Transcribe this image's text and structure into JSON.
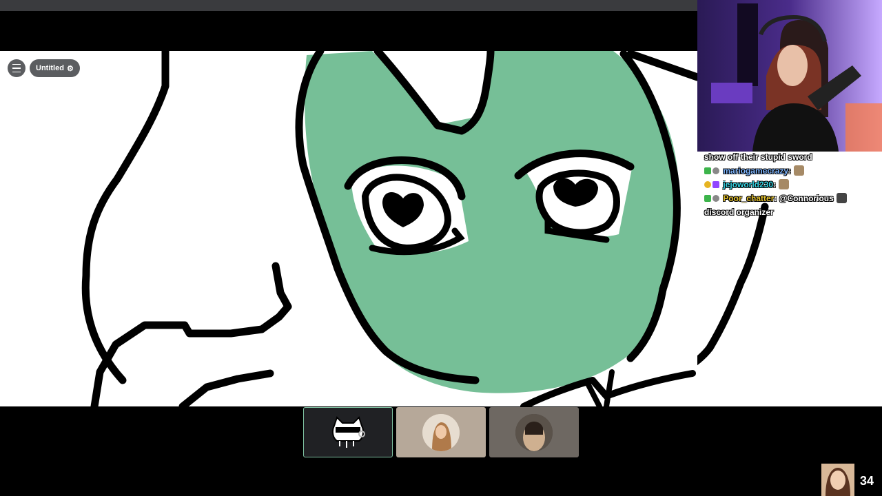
{
  "app": {
    "document_title": "Untitled"
  },
  "chat": [
    {
      "user": "",
      "message": "show off their stupid sword",
      "user_color": "#ffffff",
      "badges": [],
      "emote": false
    },
    {
      "user": "mariogamecrazy",
      "message": "",
      "user_color": "#7fb6ff",
      "badges": [
        "#3cb44b",
        "#888888"
      ],
      "emote": true
    },
    {
      "user": "jejoworld230",
      "message": "",
      "user_color": "#35d6e6",
      "badges": [
        "#e6b422",
        "#9146ff"
      ],
      "emote": true
    },
    {
      "user": "Poor_chatter",
      "message": "@Connorious",
      "user_color": "#e6c32c",
      "badges": [
        "#3cb44b",
        "#888888"
      ],
      "emote": true
    },
    {
      "user": "",
      "message": "discord organizer",
      "user_color": "#ffffff",
      "badges": [],
      "emote": false
    }
  ],
  "participants": [
    {
      "name": "participant-1",
      "selected": true,
      "tile_color": "#202124"
    },
    {
      "name": "participant-2",
      "selected": false,
      "tile_color": "#b6a899"
    },
    {
      "name": "participant-3",
      "selected": false,
      "tile_color": "#6e6862"
    }
  ],
  "viewers": {
    "count": "34"
  },
  "colors": {
    "fill_green": "#76bf97",
    "tile_border": "#7fc2a2",
    "toolbar_pill": "#5b5d60"
  }
}
